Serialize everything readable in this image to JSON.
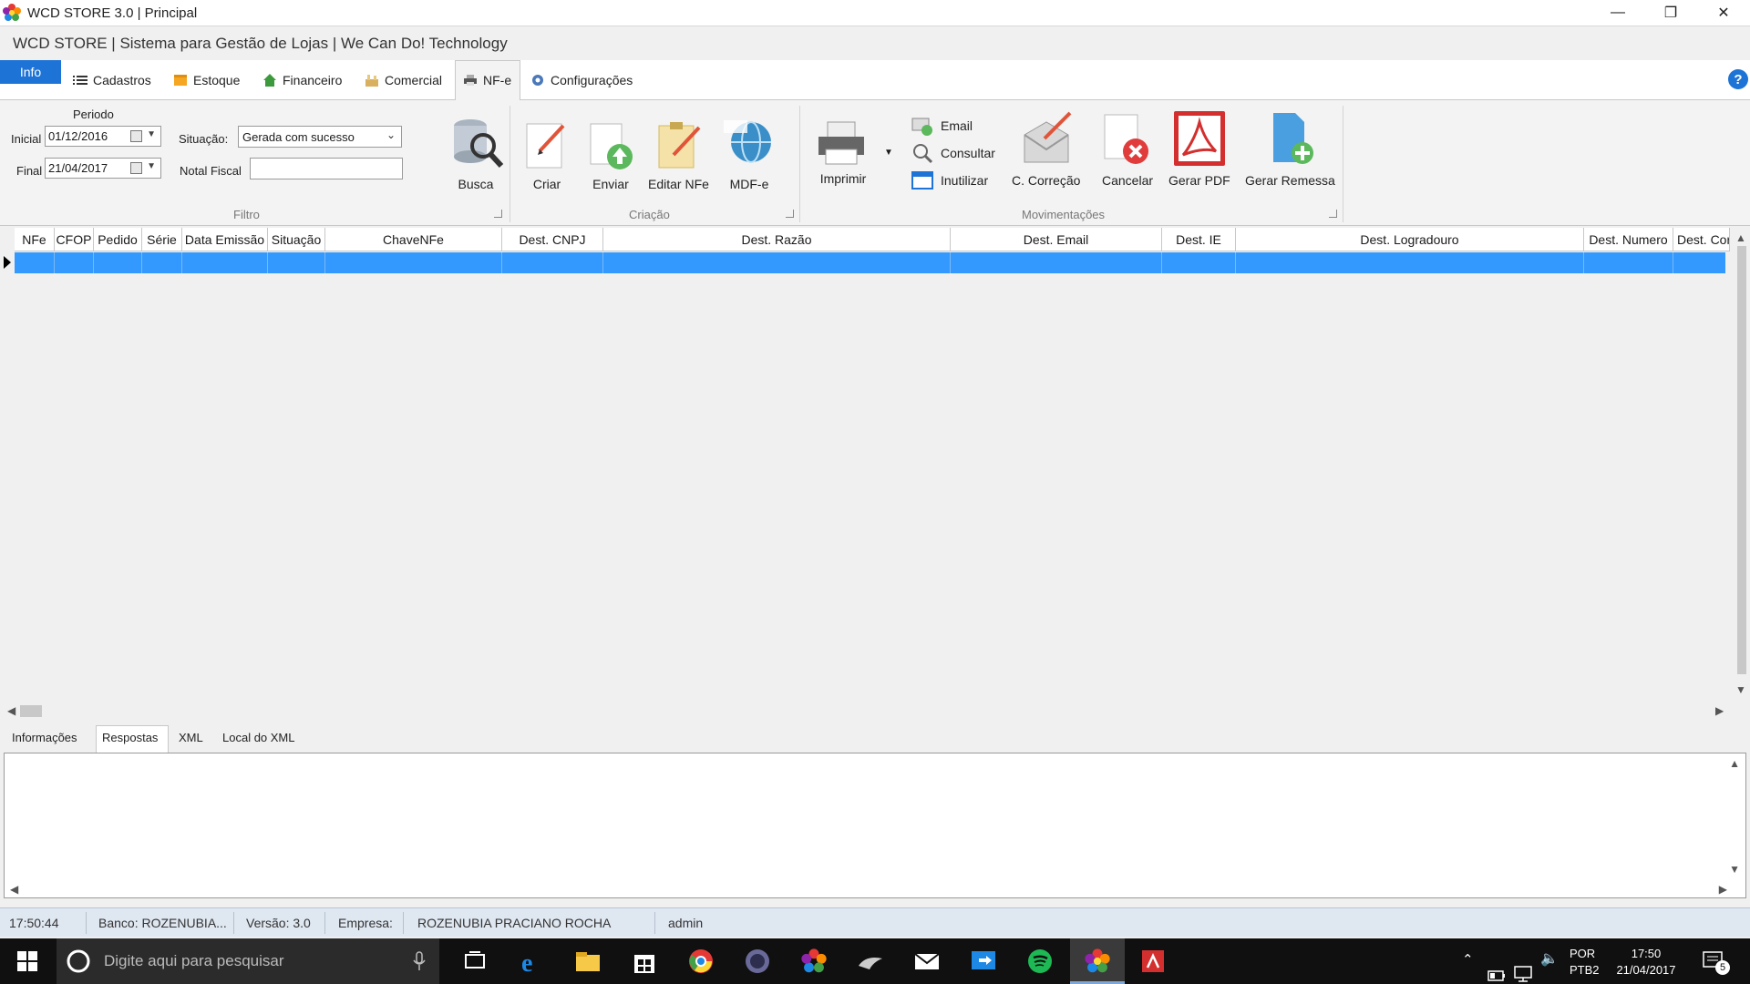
{
  "window": {
    "title": "WCD STORE 3.0 | Principal",
    "subtitle": "WCD STORE | Sistema para Gestão de Lojas | We Can Do! Technology",
    "minimize": "—",
    "restore": "❐",
    "close": "✕"
  },
  "tabs": {
    "info": "Info",
    "items": [
      {
        "label": "Cadastros",
        "icon": "list-icon"
      },
      {
        "label": "Estoque",
        "icon": "box-icon"
      },
      {
        "label": "Financeiro",
        "icon": "house-icon"
      },
      {
        "label": "Comercial",
        "icon": "shop-icon"
      },
      {
        "label": "NF-e",
        "icon": "printer-icon"
      },
      {
        "label": "Configurações",
        "icon": "gear-icon"
      }
    ],
    "help": "?"
  },
  "filtro": {
    "periodo_label": "Periodo",
    "inicial_label": "Inicial",
    "inicial_value": "01/12/2016",
    "final_label": "Final",
    "final_value": "21/04/2017",
    "situacao_label": "Situação:",
    "situacao_value": "Gerada com sucesso",
    "nota_label": "Notal Fiscal",
    "nota_value": "",
    "group_label": "Filtro"
  },
  "ribbon": {
    "busca": "Busca",
    "criar": "Criar",
    "enviar": "Enviar",
    "editar": "Editar NFe",
    "mdfe": "MDF-e",
    "criacao_label": "Criação",
    "imprimir": "Imprimir",
    "email": "Email",
    "consultar": "Consultar",
    "inutilizar": "Inutilizar",
    "correcao": "C. Correção",
    "cancelar": "Cancelar",
    "gerar_pdf": "Gerar PDF",
    "gerar_remessa": "Gerar Remessa",
    "movimentacoes_label": "Movimentações"
  },
  "grid": {
    "columns": [
      "NFe",
      "CFOP",
      "Pedido",
      "Série",
      "Data Emissão",
      "Situação",
      "ChaveNFe",
      "Dest. CNPJ",
      "Dest. Razão",
      "Dest. Email",
      "Dest. IE",
      "Dest. Logradouro",
      "Dest. Numero",
      "Dest. Cor"
    ]
  },
  "bottom_tabs": [
    "Informações",
    "Respostas",
    "XML",
    "Local do XML"
  ],
  "status": {
    "time": "17:50:44",
    "banco": "Banco: ROZENUBIA...",
    "versao": "Versão: 3.0",
    "empresa_label": "Empresa:",
    "empresa": "ROZENUBIA PRACIANO ROCHA",
    "user": "admin"
  },
  "taskbar": {
    "search_placeholder": "Digite aqui para pesquisar",
    "lang_top": "POR",
    "lang_bottom": "PTB2",
    "time": "17:50",
    "date": "21/04/2017",
    "notifications": "5"
  },
  "colors": {
    "accent": "#1e74d6",
    "selected_row": "#3399ff",
    "status_bar": "#dfe7f1",
    "taskbar": "#101010"
  }
}
